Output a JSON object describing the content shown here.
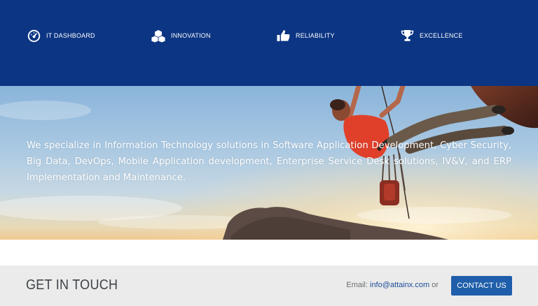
{
  "features": [
    {
      "label": "IT DASHBOARD",
      "icon": "dashboard-gauge-icon"
    },
    {
      "label": "INNOVATION",
      "icon": "cubes-icon"
    },
    {
      "label": "RELIABILITY",
      "icon": "thumbs-up-icon"
    },
    {
      "label": "EXCELLENCE",
      "icon": "trophy-icon"
    }
  ],
  "hero": {
    "text": "We specialize in Information Technology solutions in Software Application Development, Cyber Security, Big Data, DevOps, Mobile Application development, Enterprise Service Desk solutions, IV&V, and ERP Implementation and Maintenance."
  },
  "contact": {
    "title": "GET IN TOUCH",
    "email_prefix": "Email: ",
    "email": "info@attainx.com",
    "or_text": " or ",
    "button_label": "CONTACT US"
  },
  "colors": {
    "nav_band": "#0c3583",
    "button": "#1f5eaa",
    "contact_band": "#ebebeb",
    "email_link": "#1a4d96"
  }
}
